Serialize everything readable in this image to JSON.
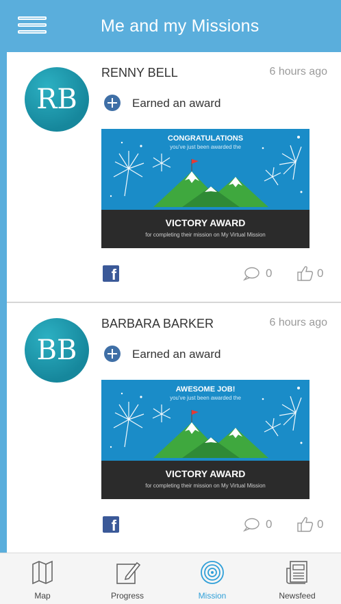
{
  "header": {
    "title": "Me and my Missions",
    "menu_icon": "hamburger-menu-icon"
  },
  "feed": [
    {
      "initials": "RB",
      "name": "RENNY BELL",
      "time": "6 hours ago",
      "action": "Earned an award",
      "award": {
        "heading": "CONGRATULATIONS",
        "subheading": "you've just been awarded the",
        "name": "VICTORY AWARD",
        "description": "for completing their mission on My Virtual Mission"
      },
      "comments": "0",
      "likes": "0"
    },
    {
      "initials": "BB",
      "name": "BARBARA BARKER",
      "time": "6 hours ago",
      "action": "Earned an award",
      "award": {
        "heading": "AWESOME JOB!",
        "subheading": "you've just been awarded the",
        "name": "VICTORY AWARD",
        "description": "for completing their mission on My Virtual Mission"
      },
      "comments": "0",
      "likes": "0"
    }
  ],
  "tabs": [
    {
      "label": "Map",
      "icon": "map-icon",
      "active": false
    },
    {
      "label": "Progress",
      "icon": "pencil-edit-icon",
      "active": false
    },
    {
      "label": "Mission",
      "icon": "target-icon",
      "active": true
    },
    {
      "label": "Newsfeed",
      "icon": "newspaper-icon",
      "active": false
    }
  ],
  "colors": {
    "header": "#5aaedc",
    "avatar": "#1a98ad",
    "award_sky": "#1a8cc8",
    "award_footer": "#2b2b2b",
    "facebook": "#3b5998",
    "active_tab": "#2f9fd8"
  }
}
